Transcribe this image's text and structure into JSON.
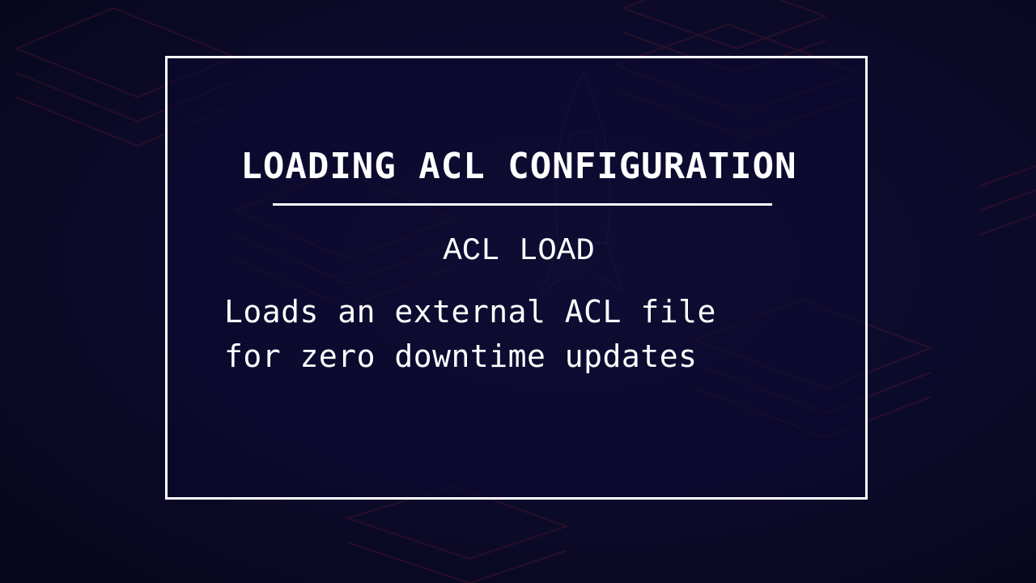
{
  "slide": {
    "title": "LOADING ACL CONFIGURATION",
    "command": "ACL LOAD",
    "description": "Loads an external ACL file\nfor zero downtime updates"
  },
  "colors": {
    "background": "#0b0a26",
    "text": "#ffffff",
    "frame": "#ffffff",
    "background_art": "#5a1a2a"
  },
  "decorations": {
    "background_art": "layered-stack-outline-pattern"
  }
}
